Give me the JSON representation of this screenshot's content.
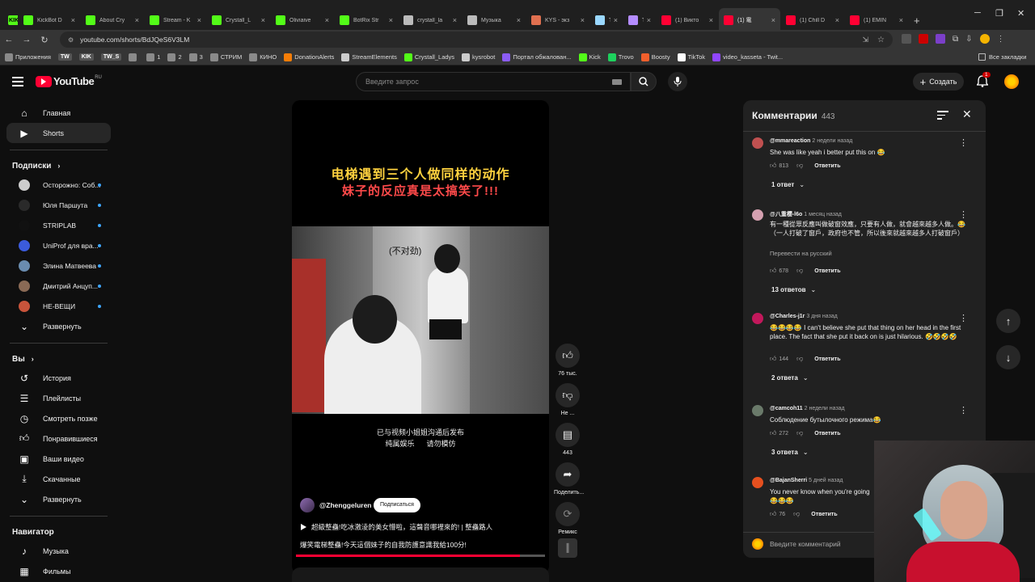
{
  "browser": {
    "tabs": [
      {
        "label": "KIK",
        "color": "#53fc18",
        "icon": "kick-icon"
      },
      {
        "label": "KickBot D",
        "color": "#53fc18",
        "icon": "kick-icon"
      },
      {
        "label": "About Cry",
        "color": "#53fc18",
        "icon": "kick-icon"
      },
      {
        "label": "Stream - K",
        "color": "#53fc18",
        "icon": "kick-icon"
      },
      {
        "label": "Crystall_L",
        "color": "#53fc18",
        "icon": "kick-icon"
      },
      {
        "label": "Oliviaive",
        "color": "#53fc18",
        "icon": "kick-icon"
      },
      {
        "label": "BotRix Str",
        "color": "#53fc18",
        "icon": "kick-icon"
      },
      {
        "label": "crystall_la",
        "color": "#bbbbbb",
        "icon": "x-icon"
      },
      {
        "label": "Музыка",
        "color": "#bbbbbb",
        "icon": "x-icon"
      },
      {
        "label": "KYS - экз",
        "color": "#e07050",
        "icon": "page-icon"
      },
      {
        "label": "TW_S",
        "color": "#9ad8ff",
        "icon": "tw-icon"
      },
      {
        "label": "TW",
        "color": "#b48cff",
        "icon": "tw-icon"
      },
      {
        "label": "(1) Викто",
        "color": "#ff0033",
        "icon": "youtube-icon"
      },
      {
        "label": "(1) 電",
        "color": "#ff0033",
        "icon": "youtube-icon"
      },
      {
        "label": "(1) Chill D",
        "color": "#ff0033",
        "icon": "youtube-icon"
      },
      {
        "label": "(1) EMIN",
        "color": "#ff0033",
        "icon": "youtube-icon"
      }
    ],
    "url": "youtube.com/shorts/BdJQeS6V3LM",
    "bookmarks": [
      {
        "label": "Приложения",
        "color": "#8a8a8a"
      },
      {
        "label": "TW",
        "color": "#555",
        "badge": true
      },
      {
        "label": "KIK",
        "color": "#555",
        "badge": true
      },
      {
        "label": "TW_S",
        "color": "#555",
        "badge": true
      },
      {
        "label": "",
        "color": "#8a8a8a"
      },
      {
        "label": "1",
        "color": "#8a8a8a"
      },
      {
        "label": "2",
        "color": "#8a8a8a"
      },
      {
        "label": "3",
        "color": "#8a8a8a"
      },
      {
        "label": "СТРИМ",
        "color": "#8a8a8a"
      },
      {
        "label": "КИНО",
        "color": "#8a8a8a"
      },
      {
        "label": "DonationAlerts",
        "color": "#f57d07"
      },
      {
        "label": "StreamElements",
        "color": "#cccccc"
      },
      {
        "label": "Crystall_Ladys",
        "color": "#53fc18"
      },
      {
        "label": "kysrobot",
        "color": "#cccccc"
      },
      {
        "label": "Портал обжалован...",
        "color": "#8b5cf6"
      },
      {
        "label": "Kick",
        "color": "#53fc18"
      },
      {
        "label": "Trovo",
        "color": "#1dd15d"
      },
      {
        "label": "Boosty",
        "color": "#f15f2c"
      },
      {
        "label": "TikTok",
        "color": "#ffffff"
      },
      {
        "label": "video_kasseta - Twit...",
        "color": "#9146ff"
      }
    ],
    "all_bookmarks": "Все закладки"
  },
  "youtube": {
    "logo_text": "YouTube",
    "logo_region": "RU",
    "search_placeholder": "Введите запрос",
    "create_label": "Создать",
    "notif_count": "1"
  },
  "sidebar": {
    "main": [
      {
        "label": "Главная",
        "icon": "home-icon"
      },
      {
        "label": "Shorts",
        "icon": "shorts-icon",
        "active": true
      }
    ],
    "subs_title": "Подписки",
    "subs": [
      {
        "label": "Осторожно: Соб...",
        "color": "#cccccc"
      },
      {
        "label": "Юля Паршута",
        "color": "#2a2a2a"
      },
      {
        "label": "STRIPLAB",
        "color": "#111111"
      },
      {
        "label": "UniProf для вра...",
        "color": "#3b5bdb"
      },
      {
        "label": "Элина Матвеева",
        "color": "#6a8caf"
      },
      {
        "label": "Дмитрий Анцуп...",
        "color": "#8a6a55"
      },
      {
        "label": "НЕ-ВЕЩИ",
        "color": "#c9543b"
      }
    ],
    "expand1": "Развернуть",
    "you_title": "Вы",
    "you": [
      {
        "label": "История",
        "icon": "history-icon"
      },
      {
        "label": "Плейлисты",
        "icon": "playlist-icon"
      },
      {
        "label": "Смотреть позже",
        "icon": "clock-icon"
      },
      {
        "label": "Понравившиеся",
        "icon": "like-icon"
      },
      {
        "label": "Ваши видео",
        "icon": "video-icon"
      },
      {
        "label": "Скачанные",
        "icon": "download-icon"
      }
    ],
    "expand2": "Развернуть",
    "nav_title": "Навигатор",
    "nav": [
      {
        "label": "Музыка",
        "icon": "music-icon"
      },
      {
        "label": "Фильмы",
        "icon": "film-icon"
      }
    ]
  },
  "short": {
    "title_line1": "电梯遇到三个人做同样的动作",
    "title_line2": "妹子的反应真是太搞笑了!!!",
    "subtitle_bubble": "(不对劲)",
    "caption1": "已与视频小姐姐沟通后发布",
    "caption2": "纯属娱乐      请勿模仿",
    "channel": "@Zhenggeluren",
    "subscribe": "Подписаться",
    "desc_line1": "超級整蠱!吃冰激淩的美女懵啦，這聲音哪裡來的! | 整蠱路人",
    "desc_line2": "爆笑電梯整蠱!今天這個妹子的自我防護意識我給100分!",
    "progress": 0.9
  },
  "actions": {
    "likes": "76 тыс.",
    "dislike": "Не ...",
    "comments": "443",
    "share": "Поделить...",
    "remix": "Ремикс"
  },
  "comments_panel": {
    "title": "Комментарии",
    "count": "443",
    "input_placeholder": "Введите комментарий",
    "reply_label": "Ответить",
    "items": [
      {
        "author": "@mmareaction",
        "time": "2 недели назад",
        "text": "She was like yeah i better put this on 😂",
        "likes": "813",
        "replies": "1 ответ",
        "color": "#c05050"
      },
      {
        "author": "@八重櫻-l6o",
        "time": "1 месяц назад",
        "text": "有一種從眾反應叫做破窗效應，只要有人做，就會越來越多人做。😂（一人打破了窗戶，政府也不管，所以後來就越來越多人打破窗戶）",
        "translate": "Перевести на русский",
        "likes": "678",
        "replies": "13 ответов",
        "color": "#d4a0b0"
      },
      {
        "author": "@Charles-j1r",
        "time": "3 дня назад",
        "text": "😂😂😂😂 I can't believe she put that thing on her head in the first place. The fact that she put it back on is just hilarious. 🤣🤣🤣🤣",
        "likes": "144",
        "replies": "2 ответа",
        "color": "#c2185b"
      },
      {
        "author": "@camcoh11",
        "time": "2 недели назад",
        "text": "Соблюдение бутылочного режима😂",
        "likes": "272",
        "replies": "3 ответа",
        "color": "#6a7a6a"
      },
      {
        "author": "@BajanSherri",
        "time": "5 дней назад",
        "text": "You never know when you're going",
        "text2": "😂😂😂",
        "likes": "76",
        "color": "#e6501f"
      }
    ]
  }
}
